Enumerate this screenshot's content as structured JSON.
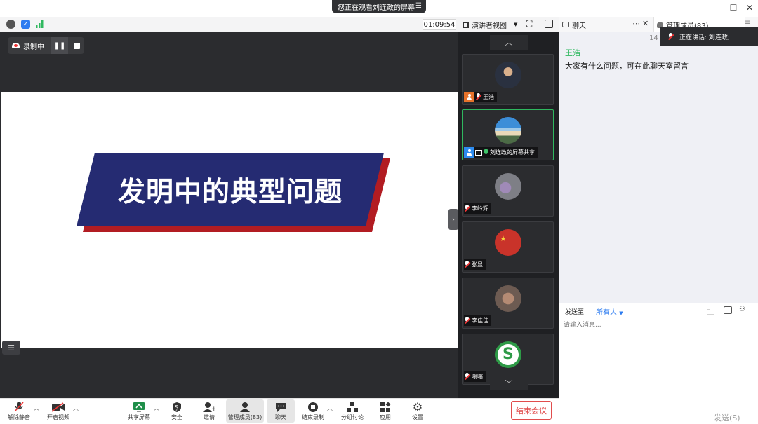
{
  "window": {
    "viewing_banner": "您正在观看刘连政的屏幕",
    "controls": [
      "minimize",
      "maximize",
      "close"
    ]
  },
  "top_toolbar": {
    "timer": "01:09:54",
    "view_mode": "演讲者视图",
    "icons": [
      "info-icon",
      "shield-icon",
      "signal-icon",
      "fullscreen-icon",
      "sidebar-toggle-icon"
    ]
  },
  "recording": {
    "status": "录制中"
  },
  "slide": {
    "title": "发明中的典型问题",
    "colors": {
      "banner": "#252b72",
      "shadow": "#b21c22"
    }
  },
  "participants": [
    {
      "name": "王浩",
      "role": "host",
      "mic": "muted"
    },
    {
      "name": "刘连政的屏幕共享",
      "role": "cohost",
      "mic": "on",
      "active": true
    },
    {
      "name": "李岭辉",
      "mic": "muted"
    },
    {
      "name": "张显",
      "mic": "muted"
    },
    {
      "name": "李佳佳",
      "mic": "muted"
    },
    {
      "name": "嗡嗡",
      "mic": "muted"
    }
  ],
  "bottom_toolbar": {
    "unmute": "解除静音",
    "start_video": "开启视频",
    "share_screen": "共享屏幕",
    "security": "安全",
    "invite": "邀请",
    "manage_members": "管理成员(83)",
    "chat": "聊天",
    "end_recording": "结束录制",
    "breakout": "分组讨论",
    "apps": "应用",
    "settings": "设置",
    "end_meeting": "结束会议"
  },
  "chat_panel": {
    "tab_chat": "聊天",
    "tab_members": "管理成员(83)",
    "partial_number": "14",
    "speaking_label": "正在讲话: 刘连政;",
    "messages": [
      {
        "sender": "王浩",
        "text": "大家有什么问题，可在此聊天室留言"
      }
    ],
    "send_to_label": "发送至:",
    "recipient": "所有人",
    "input_placeholder": "请输入消息...",
    "send_label": "发送(S)",
    "accent_color": "#2fb85f"
  }
}
